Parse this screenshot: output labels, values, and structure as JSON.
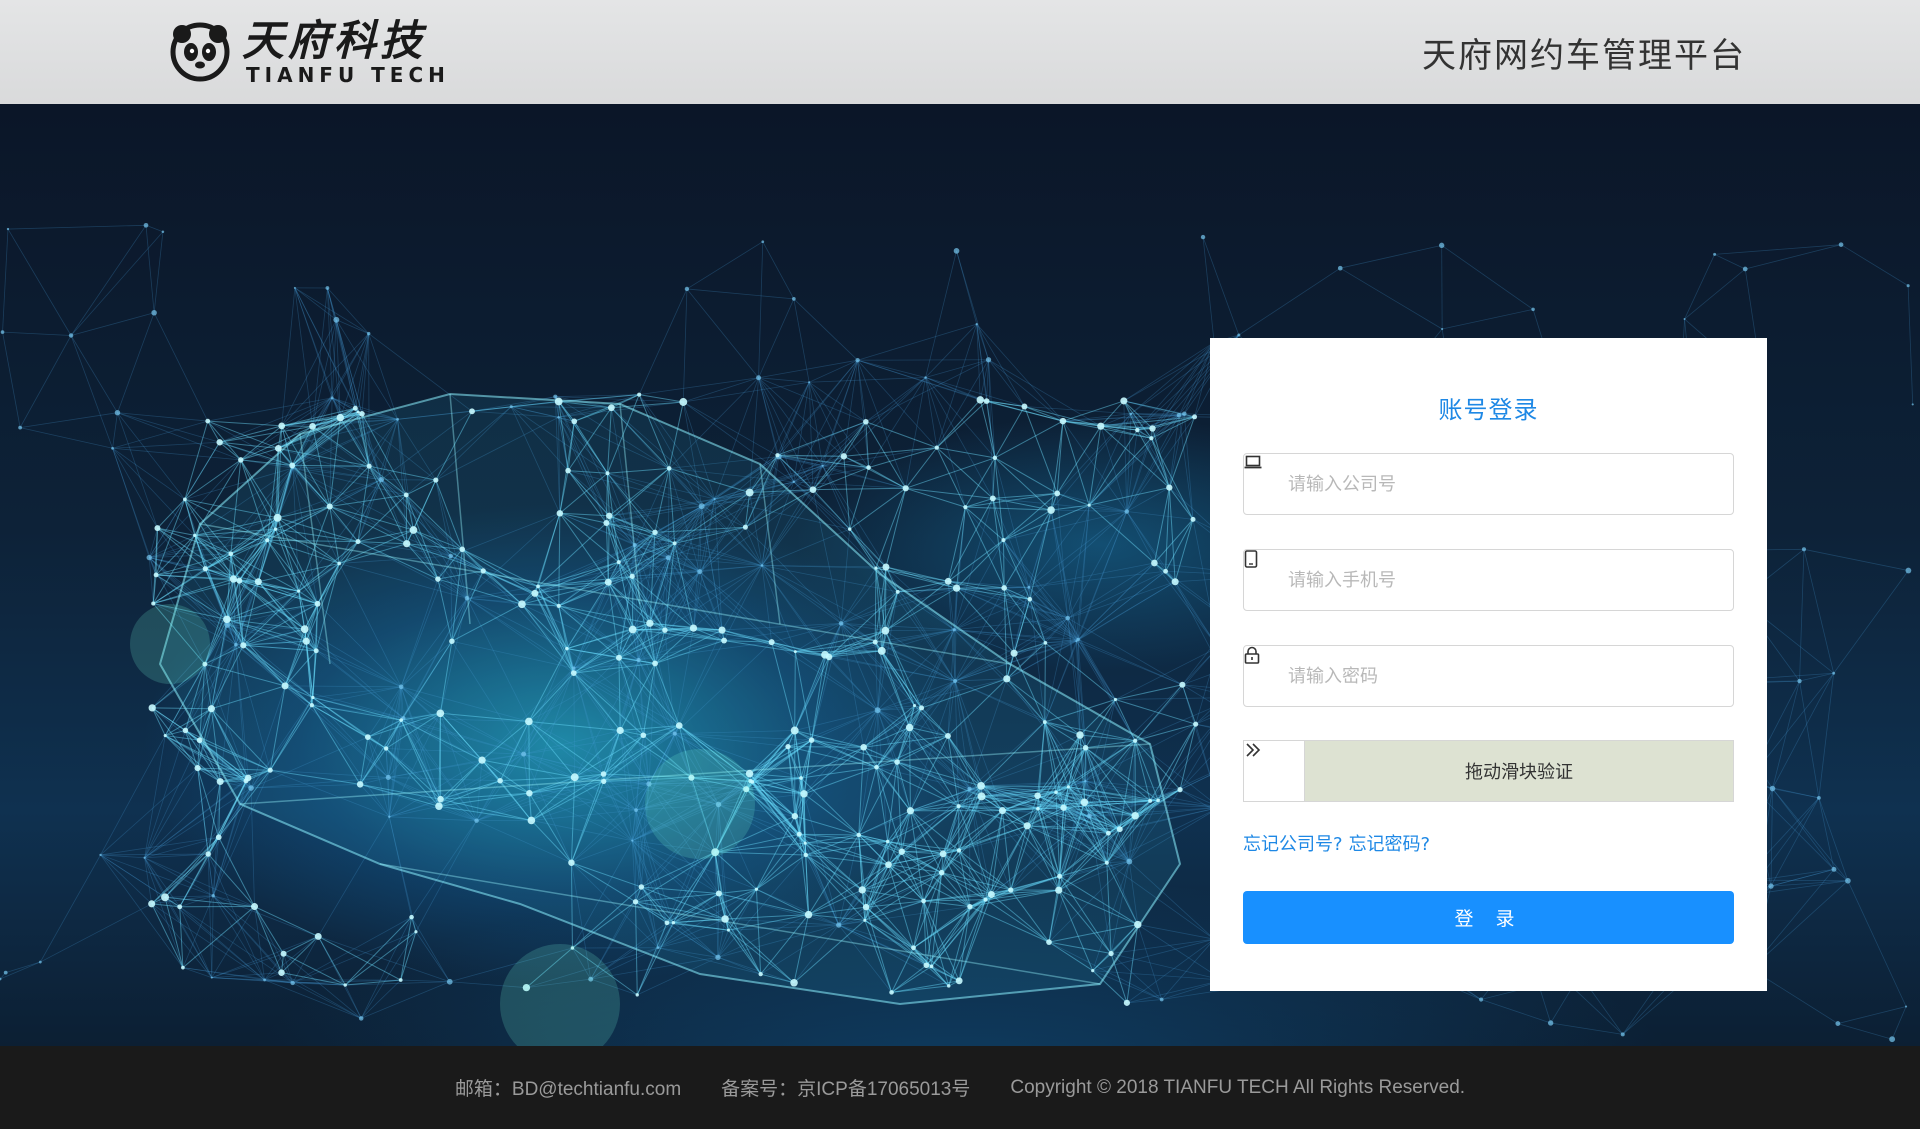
{
  "header": {
    "logo_cn": "天府科技",
    "logo_en": "TIANFU TECH",
    "platform_title": "天府网约车管理平台"
  },
  "login": {
    "title": "账号登录",
    "company_placeholder": "请输入公司号",
    "phone_placeholder": "请输入手机号",
    "password_placeholder": "请输入密码",
    "slider_text": "拖动滑块验证",
    "forgot_company": "忘记公司号?",
    "forgot_password": "忘记密码?",
    "submit_label": "登 录",
    "accent_color": "#1890ff"
  },
  "footer": {
    "email": "邮箱：BD@techtianfu.com",
    "icp": "备案号：京ICP备17065013号",
    "copyright": "Copyright © 2018 TIANFU TECH All Rights Reserved."
  },
  "icons": {
    "company": "laptop-icon",
    "phone": "mobile-phone-icon",
    "password": "lock-icon",
    "slider": "double-chevron-right-icon",
    "logo": "panda-logo-icon"
  }
}
